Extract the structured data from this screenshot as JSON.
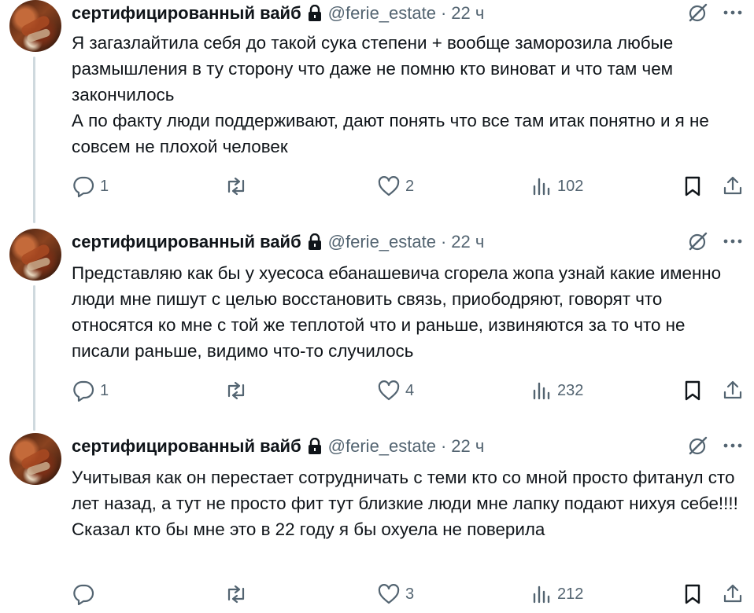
{
  "tweets": [
    {
      "name": "сертифицированный вайб",
      "handle": "@ferie_estate",
      "separator": "·",
      "time": "22 ч",
      "text": "Я загазлайтила себя до такой сука степени + вообще заморозила любые размышления в ту сторону что даже не помню кто виноват и что там чем закончилось\nА по факту люди поддерживают, дают понять что все там итак понятно и я не совсем не плохой человек",
      "replies": "1",
      "retweets": "",
      "likes": "2",
      "views": "102"
    },
    {
      "name": "сертифицированный вайб",
      "handle": "@ferie_estate",
      "separator": "·",
      "time": "22 ч",
      "text": "Представляю как бы у хуесоса ебанашевича сгорела жопа узнай какие именно люди мне пишут с целью восстановить связь, приободряют, говорят что относятся ко мне с той же теплотой что и раньше, извиняются за то что не писали раньше, видимо что-то случилось",
      "replies": "1",
      "retweets": "",
      "likes": "4",
      "views": "232"
    },
    {
      "name": "сертифицированный вайб",
      "handle": "@ferie_estate",
      "separator": "·",
      "time": "22 ч",
      "text": "Учитывая как он перестает сотрудничать с теми кто со мной просто фитанул сто лет назад, а тут не просто фит тут близкие люди мне лапку подают нихуя себе!!!! Сказал кто бы мне это в 22 году я бы охуела не поверила",
      "replies": "",
      "retweets": "",
      "likes": "3",
      "views": "212"
    }
  ],
  "colors": {
    "text": "#0f1419",
    "muted": "#536471",
    "thread_line": "#cfd9de"
  },
  "icons": [
    "lock-icon",
    "grok-icon",
    "more-icon",
    "reply-icon",
    "retweet-icon",
    "like-icon",
    "views-icon",
    "bookmark-icon",
    "share-icon"
  ]
}
